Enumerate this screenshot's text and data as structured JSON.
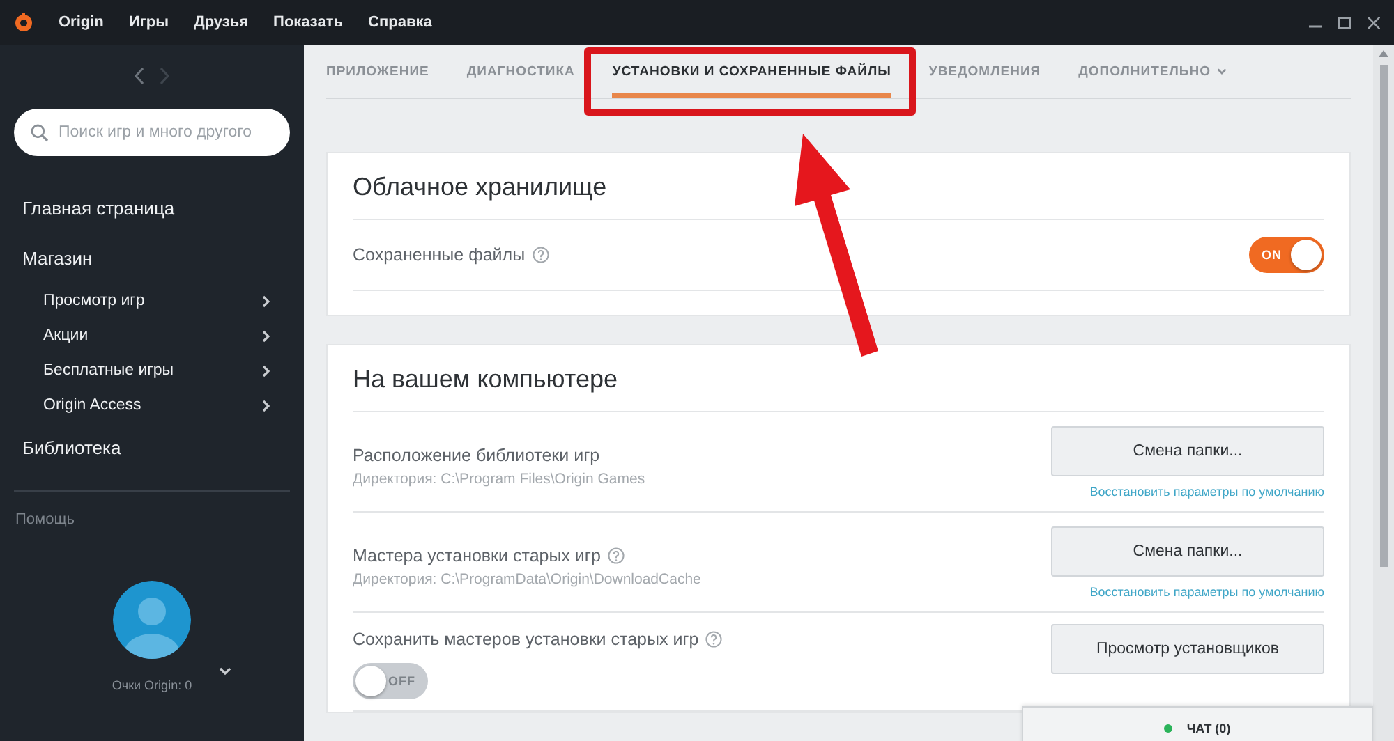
{
  "menu": [
    "Origin",
    "Игры",
    "Друзья",
    "Показать",
    "Справка"
  ],
  "sidebar": {
    "search": {
      "placeholder": "Поиск игр и много другого"
    },
    "items": [
      {
        "label": "Главная страница",
        "kind": "main"
      },
      {
        "label": "Магазин",
        "kind": "main"
      },
      {
        "label": "Просмотр игр",
        "kind": "sub"
      },
      {
        "label": "Акции",
        "kind": "sub"
      },
      {
        "label": "Бесплатные игры",
        "kind": "sub"
      },
      {
        "label": "Origin Access",
        "kind": "sub"
      },
      {
        "label": "Библиотека",
        "kind": "main"
      }
    ],
    "help": "Помощь",
    "points": "Очки Origin: 0"
  },
  "tabs": [
    {
      "label": "ПРИЛОЖЕНИЕ",
      "selected": false
    },
    {
      "label": "ДИАГНОСТИКА",
      "selected": false
    },
    {
      "label": "УСТАНОВКИ И СОХРАНЕННЫЕ ФАЙЛЫ",
      "selected": true
    },
    {
      "label": "УВЕДОМЛЕНИЯ",
      "selected": false
    },
    {
      "label": "ДОПОЛНИТЕЛЬНО",
      "selected": false,
      "kind": "dropdown"
    }
  ],
  "sections": [
    {
      "title": "Облачное хранилище",
      "rows": [
        {
          "kind": "toggle",
          "label": "Сохраненные файлы",
          "help": true,
          "toggle": {
            "on": true,
            "label": "ON"
          }
        }
      ]
    },
    {
      "title": "На вашем компьютере",
      "rows": [
        {
          "kind": "folder",
          "label": "Расположение библиотеки игр",
          "help": false,
          "path": "Директория: C:\\Program Files\\Origin Games",
          "button": "Смена папки...",
          "link": "Восстановить параметры по умолчанию"
        },
        {
          "kind": "folder",
          "label": "Мастера установки старых игр",
          "help": true,
          "path": "Директория: C:\\ProgramData\\Origin\\DownloadCache",
          "button": "Смена папки...",
          "link": "Восстановить параметры по умолчанию"
        },
        {
          "kind": "toggle",
          "label": "Сохранить мастеров установки старых игр",
          "help": true,
          "toggle": {
            "on": false,
            "label": "OFF"
          },
          "button": "Просмотр установщиков"
        }
      ]
    }
  ],
  "chat": {
    "label": "ЧАТ (0)",
    "color": "#2bb35a"
  }
}
